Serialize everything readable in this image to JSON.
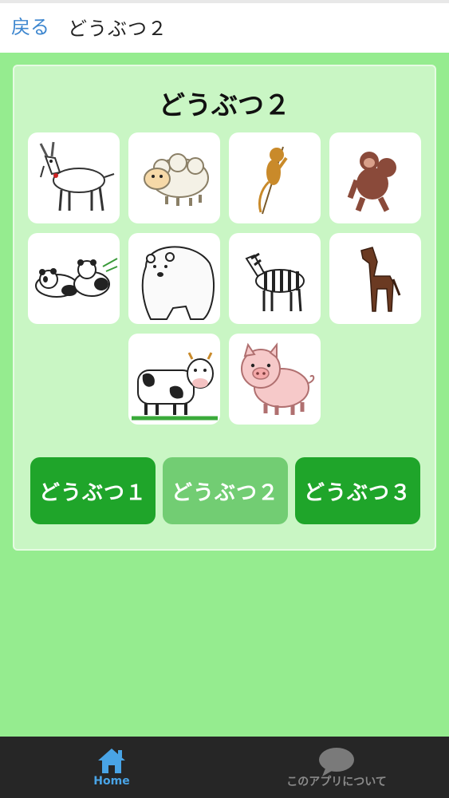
{
  "header": {
    "back_label": "戻る",
    "title": "どうぶつ２"
  },
  "panel": {
    "title": "どうぶつ２",
    "animals": [
      {
        "name": "goat-image"
      },
      {
        "name": "sheep-image"
      },
      {
        "name": "monkey-image"
      },
      {
        "name": "gorilla-image"
      },
      {
        "name": "panda-image"
      },
      {
        "name": "polar-bear-image"
      },
      {
        "name": "zebra-image"
      },
      {
        "name": "horse-image"
      },
      {
        "name": "cow-image"
      },
      {
        "name": "pig-image"
      }
    ],
    "buttons": [
      {
        "label": "どうぶつ１",
        "state": "normal"
      },
      {
        "label": "どうぶつ２",
        "state": "selected"
      },
      {
        "label": "どうぶつ３",
        "state": "normal"
      }
    ]
  },
  "bottom_nav": {
    "home_label": "Home",
    "about_label": "このアプリについて",
    "home_icon": "home-icon",
    "about_icon": "speech-bubble-icon"
  },
  "colors": {
    "background": "#95ec8f",
    "panel": "#c9f6c4",
    "button": "#1fa52a",
    "button_selected": "#72cd73",
    "link": "#3d86cf",
    "bottom_bar": "#262626"
  }
}
